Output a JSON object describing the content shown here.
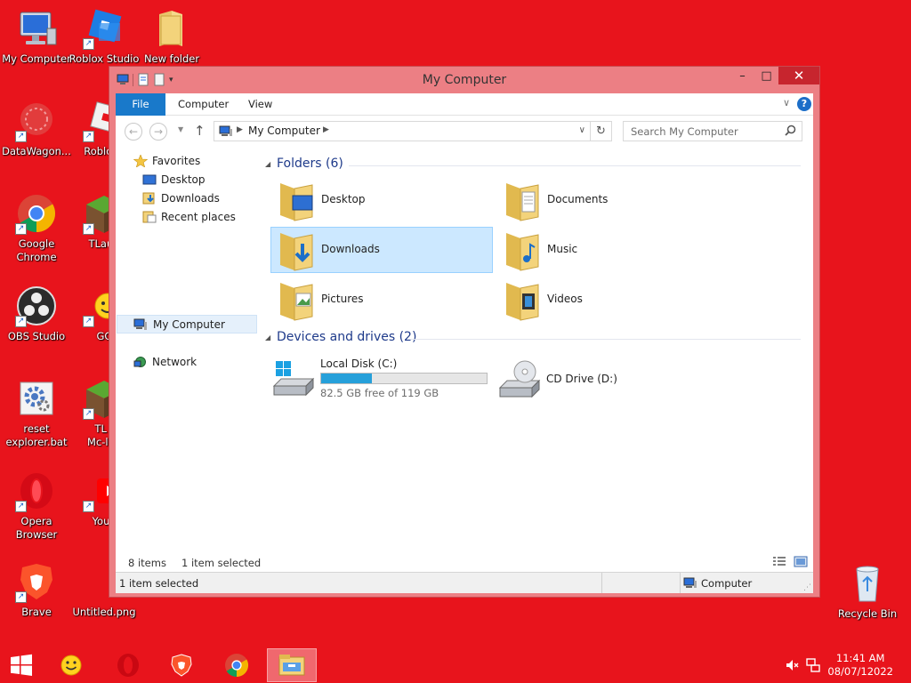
{
  "desktop": {
    "icons": [
      {
        "label": "My Computer",
        "icon": "monitor-icon"
      },
      {
        "label": "Roblox Studio",
        "icon": "roblox-studio-icon"
      },
      {
        "label": "New folder",
        "icon": "folder-icon"
      },
      {
        "label": "DataWagon...",
        "icon": "datawagon-icon"
      },
      {
        "label": "Roblox I",
        "icon": "roblox-icon"
      },
      {
        "label": "Google\nChrome",
        "icon": "chrome-icon"
      },
      {
        "label": "TLaun",
        "icon": "tlauncher-icon"
      },
      {
        "label": "OBS Studio",
        "icon": "obs-icon"
      },
      {
        "label": "GC",
        "icon": "smiley-icon"
      },
      {
        "label": "reset\nexplorer.bat",
        "icon": "gear-icon"
      },
      {
        "label": "TL f\nMc-lau",
        "icon": "minecraft-icon"
      },
      {
        "label": "Opera\nBrowser",
        "icon": "opera-icon"
      },
      {
        "label": "YouT",
        "icon": "youtube-icon"
      },
      {
        "label": "Brave",
        "icon": "brave-icon"
      },
      {
        "label": "Untitled.png",
        "icon": "image-icon"
      },
      {
        "label": "Recycle Bin",
        "icon": "recycle-bin-icon"
      }
    ]
  },
  "window": {
    "title": "My Computer",
    "controls": {
      "minimize": "–",
      "maximize": "□",
      "close": "✕"
    },
    "ribbon": {
      "tabs": [
        "File",
        "Computer",
        "View"
      ],
      "help": "?",
      "expand": "∨"
    },
    "address": {
      "back": "←",
      "forward": "→",
      "up": "↑",
      "separator": "▶",
      "crumb": "My Computer",
      "dropdown": "∨",
      "refresh": "↻",
      "search_placeholder": "Search My Computer"
    },
    "nav": {
      "favorites": "Favorites",
      "desktop": "Desktop",
      "downloads": "Downloads",
      "recent": "Recent places",
      "mycomputer": "My Computer",
      "network": "Network"
    },
    "groups": {
      "folders_header": "Folders (6)",
      "devices_header": "Devices and drives (2)"
    },
    "folders": [
      {
        "name": "Desktop"
      },
      {
        "name": "Documents"
      },
      {
        "name": "Downloads"
      },
      {
        "name": "Music"
      },
      {
        "name": "Pictures"
      },
      {
        "name": "Videos"
      }
    ],
    "drives": [
      {
        "name": "Local Disk (C:)",
        "free_text": "82.5 GB free of 119 GB",
        "used_fraction": 0.307
      },
      {
        "name": "CD Drive (D:)"
      }
    ],
    "status": {
      "items": "8 items",
      "selected": "1 item selected",
      "details_selected": "1 item selected",
      "details_location": "Computer"
    }
  },
  "taskbar": {
    "time": "11:41 AM",
    "date": "08/07/12022"
  },
  "colors": {
    "desktop_bg": "#e8141c",
    "window_frame": "#ec7f84",
    "accent_blue": "#1979ca",
    "selection": "#cce8ff",
    "drive_bar": "#26a0da"
  }
}
